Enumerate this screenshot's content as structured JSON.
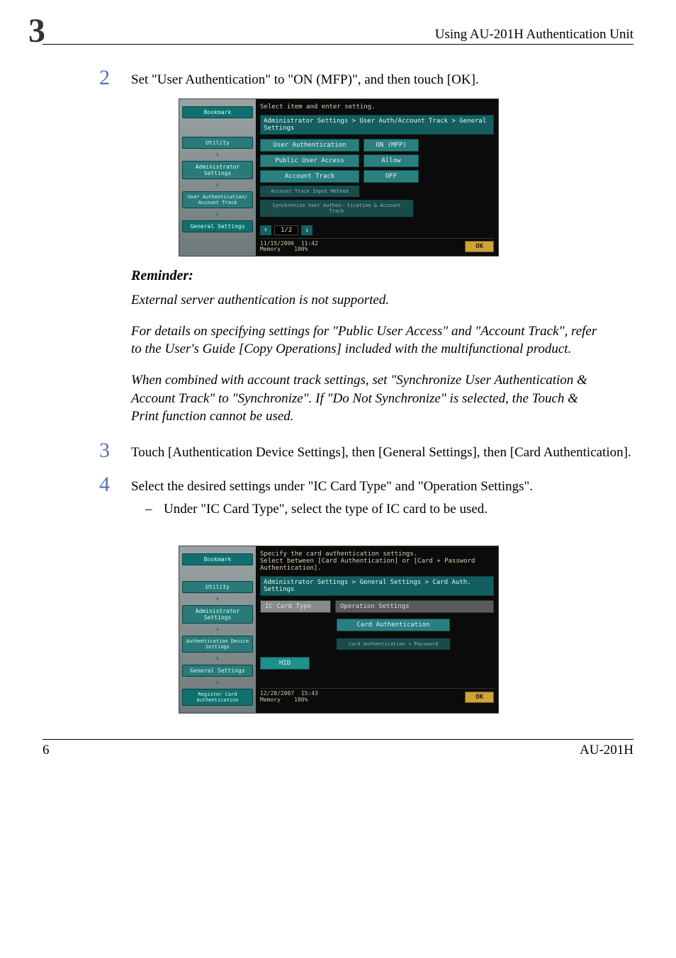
{
  "header": {
    "chapter_number": "3",
    "title": "Using AU-201H Authentication Unit"
  },
  "steps": {
    "s2": {
      "num": "2",
      "text": "Set \"User Authentication\" to \"ON (MFP)\", and then touch [OK]."
    },
    "s3": {
      "num": "3",
      "text": "Touch [Authentication Device Settings], then [General Settings], then [Card Authentication]."
    },
    "s4": {
      "num": "4",
      "text": "Select the desired settings under \"IC Card Type\" and \"Operation Settings\".",
      "bullet1": "Under \"IC Card Type\", select the type of IC card to be used."
    }
  },
  "reminder": {
    "title": "Reminder:",
    "p1": "External server authentication is not supported.",
    "p2": "For details on specifying settings for \"Public User Access\" and \"Account Track\", refer to the User's Guide [Copy Operations] included with the multifunctional product.",
    "p3": "When combined with account track settings, set \"Synchronize User Authentication & Account Track\" to \"Synchronize\". If \"Do Not Synchronize\" is selected, the Touch & Print function cannot be used."
  },
  "screen1": {
    "instruction": "Select item and enter setting.",
    "breadcrumb": "Administrator Settings > User Auth/Account Track  > General Settings",
    "side": {
      "bookmark": "Bookmark",
      "utility": "Utility",
      "admin": "Administrator Settings",
      "uaat": "User Authentication/ Account Track",
      "general": "General Settings"
    },
    "rows": {
      "ua_label": "User Authentication",
      "ua_value": "ON (MFP)",
      "pua_label": "Public User Access",
      "pua_value": "Allow",
      "at_label": "Account Track",
      "at_value": "OFF",
      "atim_label": "Account Track Input Method",
      "sync_label": "Synchronize User Authen- tication & Account Track"
    },
    "pager": "1/2",
    "status_date": "11/15/2006",
    "status_time": "11:42",
    "status_mem": "Memory",
    "status_pct": "100%",
    "ok": "OK"
  },
  "screen2": {
    "instruction": "Specify the card authentication settings.\nSelect between [Card Authentication] or [Card + Password Authentication].",
    "breadcrumb": "Administrator Settings > General Settings > Card Auth. Settings",
    "side": {
      "bookmark": "Bookmark",
      "utility": "Utility",
      "admin": "Administrator Settings",
      "ads": "Authentication Device Settings",
      "general": "General Settings",
      "rca": "Register Card Authentication"
    },
    "tabs": {
      "ic": "IC Card Type",
      "ops": "Operation Settings"
    },
    "buttons": {
      "card_auth": "Card Authentication",
      "card_pw": "Card Authentication + Password",
      "hid": "HID"
    },
    "status_date": "12/28/2007",
    "status_time": "15:43",
    "status_mem": "Memory",
    "status_pct": "100%",
    "ok": "OK"
  },
  "footer": {
    "page_number": "6",
    "model": "AU-201H"
  }
}
